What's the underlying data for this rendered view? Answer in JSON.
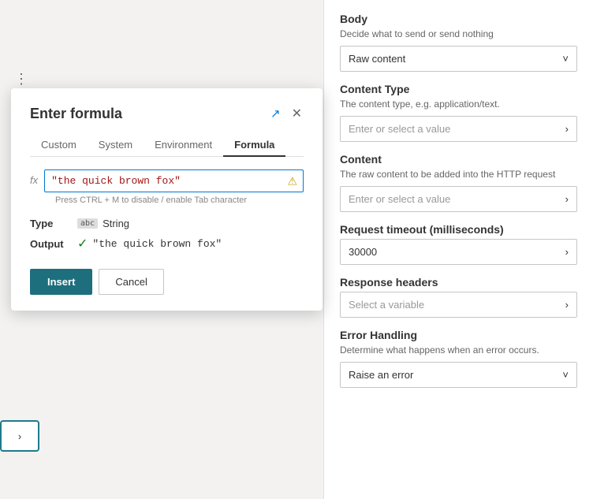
{
  "dialog": {
    "title": "Enter formula",
    "tabs": [
      {
        "id": "custom",
        "label": "Custom"
      },
      {
        "id": "system",
        "label": "System"
      },
      {
        "id": "environment",
        "label": "Environment"
      },
      {
        "id": "formula",
        "label": "Formula"
      }
    ],
    "active_tab": "formula",
    "fx_label": "fx",
    "formula_value": "\"the quick brown fox\"",
    "formula_hint": "Press CTRL + M to disable / enable Tab character",
    "info_icon": "⚠",
    "type_label": "Type",
    "type_icon_text": "abc",
    "type_value": "String",
    "output_label": "Output",
    "output_check": "✓",
    "output_value": "\"the quick brown fox\"",
    "insert_label": "Insert",
    "cancel_label": "Cancel",
    "expand_icon": "↗",
    "close_icon": "✕"
  },
  "right_panel": {
    "body_section": {
      "title": "Body",
      "subtitle": "Decide what to send or send nothing",
      "dropdown_value": "Raw content",
      "chevron": "˅"
    },
    "content_type_section": {
      "title": "Content Type",
      "subtitle": "The content type, e.g. application/text.",
      "placeholder": "Enter or select a value",
      "arrow": "›"
    },
    "content_section": {
      "title": "Content",
      "subtitle": "The raw content to be added into the HTTP request",
      "placeholder": "Enter or select a value",
      "arrow": "›"
    },
    "timeout_section": {
      "title": "Request timeout (milliseconds)",
      "value": "30000",
      "arrow": "›"
    },
    "response_headers_section": {
      "title": "Response headers",
      "placeholder": "Select a variable",
      "arrow": "›"
    },
    "error_handling_section": {
      "title": "Error Handling",
      "subtitle": "Determine what happens when an error occurs.",
      "dropdown_value": "Raise an error",
      "chevron": "˅"
    }
  },
  "canvas": {
    "three_dots": "⋮",
    "arrow_right": "›"
  }
}
